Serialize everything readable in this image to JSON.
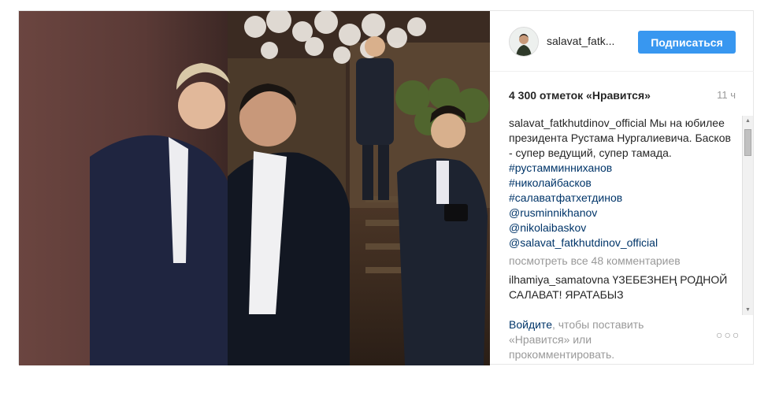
{
  "post": {
    "username": "salavat_fatk...",
    "follow_label": "Подписаться",
    "likes": "4 300 отметок «Нравится»",
    "time": "11 ч",
    "caption": {
      "author": "salavat_fatkhutdinov_official",
      "text": " Мы на юбилее президента Рустама Нургалиевича. Басков - супер ведущий, супер тамада.",
      "tags": [
        "#рустамминниханов",
        "#николайбасков",
        "#салаватфатхетдинов",
        "@rusminnikhanov",
        "@nikolaibaskov",
        "@salavat_fatkhutdinov_official"
      ]
    },
    "view_all": "посмотреть все 48 комментариев",
    "comment": {
      "author": "ilhamiya_samatovna",
      "text": " ҮЗЕБЕЗНЕҢ РОДНОЙ САЛАВАТ! ЯРАТАБЫЗ"
    },
    "login": {
      "link": "Войдите",
      "text": ", чтобы поставить «Нравится» или прокомментировать."
    },
    "more_icon": "ellipsis-icon"
  },
  "colors": {
    "accent": "#3897f0",
    "link": "#003569",
    "muted": "#999999",
    "text": "#262626"
  }
}
